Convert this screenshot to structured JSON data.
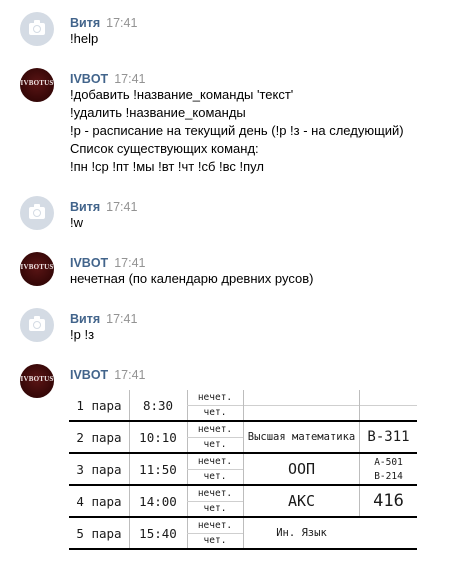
{
  "messages": [
    {
      "author": "Витя",
      "time": "17:41",
      "kind": "user",
      "lines": [
        "!help"
      ]
    },
    {
      "author": "IVBOT",
      "time": "17:41",
      "kind": "bot",
      "lines": [
        "!добавить !название_команды 'текст'",
        "!удалить !название_команды",
        "!р - расписание на текущий день (!р !з - на следующий)",
        "Список существующих команд:",
        "!пн !ср !пт !мы !вт !чт !сб !вс !пул"
      ]
    },
    {
      "author": "Витя",
      "time": "17:41",
      "kind": "user",
      "lines": [
        "!w"
      ]
    },
    {
      "author": "IVBOT",
      "time": "17:41",
      "kind": "bot",
      "lines": [
        "нечетная (по календарю древних русов)"
      ]
    },
    {
      "author": "Витя",
      "time": "17:41",
      "kind": "user",
      "lines": [
        "!р !з"
      ]
    },
    {
      "author": "IVBOT",
      "time": "17:41",
      "kind": "bot",
      "lines": []
    }
  ],
  "bot_logo_text": "IVBOTUS",
  "schedule": {
    "odd_label": "нечет.",
    "even_label": "чет.",
    "rows": [
      {
        "pair": "1 пара",
        "time": "8:30",
        "odd_subject": "",
        "even_subject": "",
        "subject": "",
        "room": "",
        "room_odd": "",
        "room_even": ""
      },
      {
        "pair": "2 пара",
        "time": "10:10",
        "subject": "Высшая математика",
        "room": "В-311",
        "room_odd": "",
        "room_even": ""
      },
      {
        "pair": "3 пара",
        "time": "11:50",
        "subject": "ООП",
        "room": "",
        "room_odd": "А-501",
        "room_even": "В-214"
      },
      {
        "pair": "4 пара",
        "time": "14:00",
        "subject": "АКС",
        "room": "416",
        "room_odd": "",
        "room_even": ""
      },
      {
        "pair": "5 пара",
        "time": "15:40",
        "subject": "Ин. Язык",
        "room": "",
        "room_odd": "",
        "room_even": ""
      }
    ]
  }
}
